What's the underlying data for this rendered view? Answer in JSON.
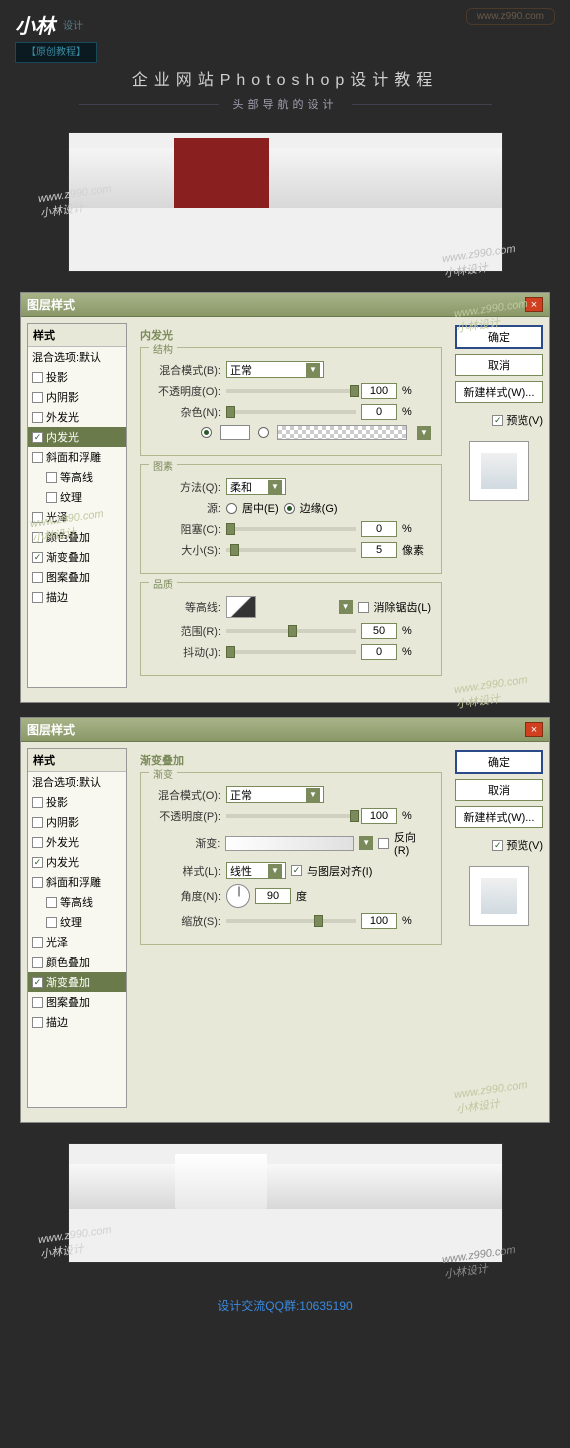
{
  "header": {
    "logo": "小林",
    "logo_sub": "设计",
    "badge": "【原创教程】",
    "url": "www.z990.com"
  },
  "title": {
    "main": "企业网站Photoshop设计教程",
    "sub": "头部导航的设计"
  },
  "watermark": {
    "url": "www.z990.com",
    "name": "小林设计"
  },
  "dialog1": {
    "title": "图层样式",
    "panel_title": "内发光",
    "sections": {
      "structure": "结构",
      "element": "图素",
      "quality": "品质"
    },
    "fields": {
      "blend_mode": "混合模式(B):",
      "blend_value": "正常",
      "opacity": "不透明度(O):",
      "opacity_val": "100",
      "noise": "杂色(N):",
      "noise_val": "0",
      "method": "方法(Q):",
      "method_val": "柔和",
      "source": "源:",
      "source_center": "居中(E)",
      "source_edge": "边缘(G)",
      "choke": "阻塞(C):",
      "choke_val": "0",
      "size": "大小(S):",
      "size_val": "5",
      "size_unit": "像素",
      "contour": "等高线:",
      "antialias": "消除锯齿(L)",
      "range": "范围(R):",
      "range_val": "50",
      "jitter": "抖动(J):",
      "jitter_val": "0",
      "percent": "%"
    }
  },
  "dialog2": {
    "title": "图层样式",
    "panel_title": "渐变叠加",
    "section": "渐变",
    "fields": {
      "blend_mode": "混合模式(O):",
      "blend_value": "正常",
      "opacity": "不透明度(P):",
      "opacity_val": "100",
      "gradient": "渐变:",
      "reverse": "反向(R)",
      "style": "样式(L):",
      "style_val": "线性",
      "align": "与图层对齐(I)",
      "angle": "角度(N):",
      "angle_val": "90",
      "angle_unit": "度",
      "scale": "缩放(S):",
      "scale_val": "100",
      "percent": "%"
    }
  },
  "styles": {
    "header": "样式",
    "blend_default": "混合选项:默认",
    "drop_shadow": "投影",
    "inner_shadow": "内阴影",
    "outer_glow": "外发光",
    "inner_glow": "内发光",
    "bevel": "斜面和浮雕",
    "contour": "等高线",
    "texture": "纹理",
    "satin": "光泽",
    "color_overlay": "颜色叠加",
    "gradient_overlay": "渐变叠加",
    "pattern_overlay": "图案叠加",
    "stroke": "描边"
  },
  "buttons": {
    "ok": "确定",
    "cancel": "取消",
    "new_style": "新建样式(W)...",
    "preview": "预览(V)"
  },
  "footer": "设计交流QQ群:10635190"
}
